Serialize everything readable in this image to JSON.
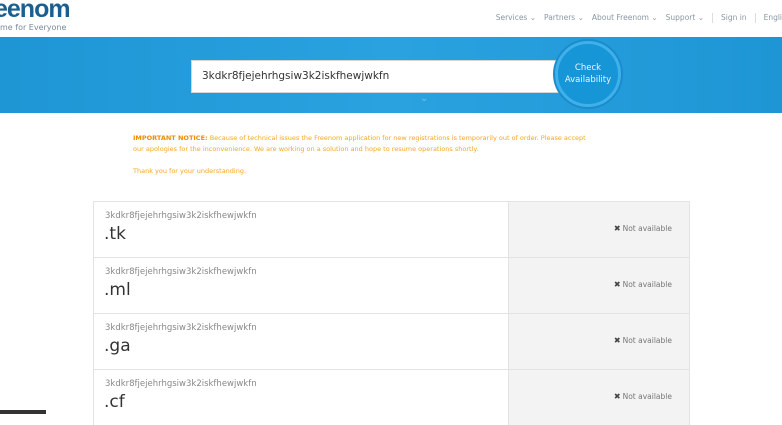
{
  "header": {
    "logo": "eenom",
    "tagline": "me for Everyone",
    "nav": [
      "Services ⌄",
      "Partners ⌄",
      "About Freenom ⌄",
      "Support ⌄"
    ],
    "sign_in": "Sign in",
    "language": "Engli"
  },
  "search": {
    "value": "3kdkr8fjejehrhgsiw3k2iskfhewjwkfn",
    "button": "Check\nAvailability"
  },
  "notice": {
    "label": "IMPORTANT NOTICE:",
    "text": "Because of technical issues the Freenom application for new registrations is temporarily out of order. Please accept our apologies for the inconvenience. We are working on a solution and hope to resume operations shortly.",
    "thanks": "Thank you for your understanding."
  },
  "results": [
    {
      "domain": "3kdkr8fjejehrhgsiw3k2iskfhewjwkfn",
      "tld": ".tk",
      "status": "Not available"
    },
    {
      "domain": "3kdkr8fjejehrhgsiw3k2iskfhewjwkfn",
      "tld": ".ml",
      "status": "Not available"
    },
    {
      "domain": "3kdkr8fjejehrhgsiw3k2iskfhewjwkfn",
      "tld": ".ga",
      "status": "Not available"
    },
    {
      "domain": "3kdkr8fjejehrhgsiw3k2iskfhewjwkfn",
      "tld": ".cf",
      "status": "Not available"
    }
  ],
  "status_icon": "close-icon"
}
